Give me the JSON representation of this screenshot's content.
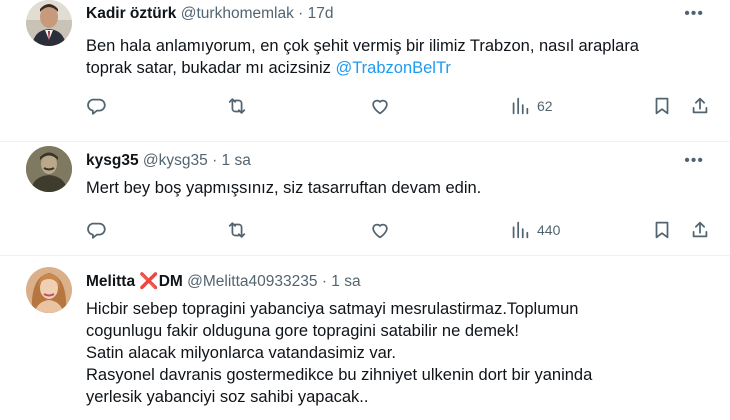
{
  "tweets": [
    {
      "name": "Kadir öztürk",
      "handle": "@turkhomemlak",
      "dot": "·",
      "time": "17d",
      "lines": [
        "Ben hala anlamıyorum, en çok şehit vermiş bir ilimiz Trabzon, nasıl araplara",
        "toprak satar, bukadar mı acizsiniz "
      ],
      "mention": "@TrabzonBelTr",
      "views": "62"
    },
    {
      "name": "kysg35",
      "handle": "@kysg35",
      "dot": "·",
      "time": "1 sa",
      "lines": [
        "Mert bey boş yapmışsınız,  siz tasarruftan devam edin."
      ],
      "views": "440"
    },
    {
      "name": "Melitta ",
      "name_mark": "❌",
      "name_suffix": "DM",
      "handle": "@Melitta40933235",
      "dot": "·",
      "time": "1 sa",
      "lines": [
        "Hicbir sebep topragini yabanciya satmayi mesrulastirmaz.Toplumun",
        "cogunlugu fakir olduguna gore topragini satabilir ne demek!",
        "Satin alacak milyonlarca vatandasimiz var.",
        "Rasyonel davranis gostermedikce bu zihniyet ulkenin dort bir yaninda",
        "yerlesik yabanciyi soz sahibi yapacak.."
      ]
    }
  ],
  "icons": {
    "more": "more-horizontal-icon",
    "reply": "reply-icon",
    "retweet": "retweet-icon",
    "like": "heart-icon",
    "views": "views-bar-chart-icon",
    "bookmark": "bookmark-icon",
    "share": "share-icon"
  },
  "colors": {
    "mention": "#1d9bf0",
    "secondary": "#536471",
    "x_mark": "#d8262b"
  }
}
